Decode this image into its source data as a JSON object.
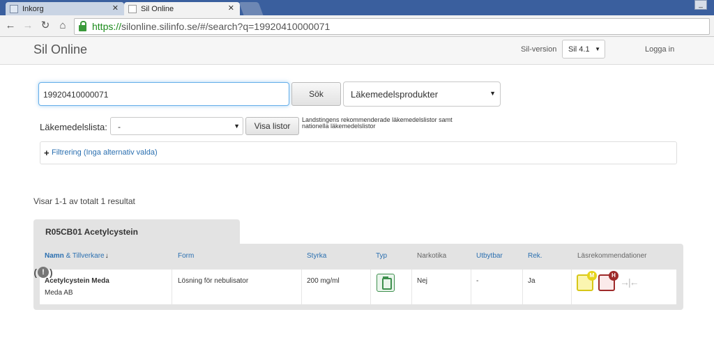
{
  "browser": {
    "tabs": [
      {
        "title": "Inkorg"
      },
      {
        "title": "Sil Online"
      }
    ],
    "url": {
      "scheme": "https://",
      "rest": "silonline.silinfo.se/#/search?q=19920410000071"
    }
  },
  "header": {
    "brand": "Sil Online",
    "version_label": "Sil-version",
    "version_value": "Sil 4.1",
    "login": "Logga in"
  },
  "search": {
    "query": "19920410000071",
    "button": "Sök",
    "type_value": "Läkemedelsprodukter"
  },
  "lists": {
    "label": "Läkemedelslista:",
    "value": "-",
    "button": "Visa listor",
    "note": "Landstingens rekommenderade läkemedelslistor samt nationella läkemedelslistor"
  },
  "filter": {
    "label": "Filtrering (Inga alternativ valda)"
  },
  "results": {
    "count_text": "Visar 1-1 av totalt 1 resultat",
    "group_title": "R05CB01 Acetylcystein",
    "columns": {
      "name": "Namn",
      "maker": "& Tillverkare",
      "form": "Form",
      "strength": "Styrka",
      "type": "Typ",
      "narcotic": "Narkotika",
      "exchangeable": "Utbytbar",
      "rek": "Rek.",
      "reading": "Läsrekommendationer"
    },
    "rows": [
      {
        "name": "Acetylcystein Meda",
        "maker": "Meda AB",
        "form": "Lösning för nebulisator",
        "strength": "200 mg/ml",
        "type_icon": "bottle-icon",
        "narcotic": "Nej",
        "exchangeable": "-",
        "rek": "Ja",
        "rec_badges": [
          "M",
          "H"
        ]
      }
    ]
  },
  "colors": {
    "link": "#2a6fb0",
    "focus": "#66afe9",
    "type_green": "#3d8f4d",
    "badge_m": "#e6d41c",
    "badge_h": "#9e2a2a"
  }
}
